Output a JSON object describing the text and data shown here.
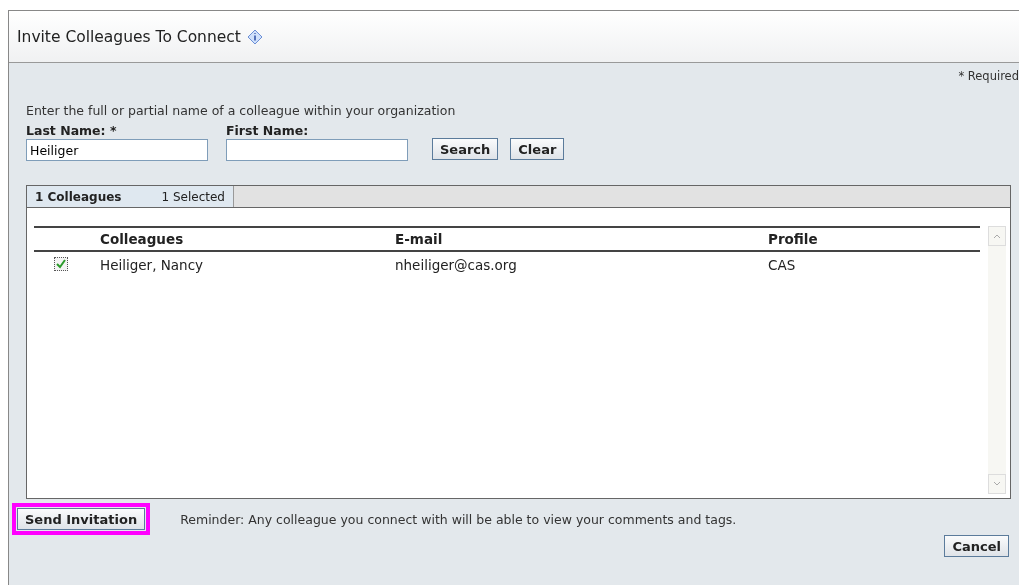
{
  "window": {
    "title": "Invite Colleagues To Connect"
  },
  "required_note": "* Required",
  "instructions": "Enter the full or partial name of a colleague within your organization",
  "fields": [
    {
      "label": "Last Name: *",
      "value": "Heiliger"
    },
    {
      "label": "First Name:"
    }
  ],
  "search_buttons": [
    "Search",
    "Clear"
  ],
  "results": {
    "count": "1 Colleagues",
    "selected_count": "1  Selected",
    "columns": [
      "Colleagues",
      "E-mail",
      "Profile"
    ],
    "rows": [
      {
        "checked": true,
        "cells": [
          "Heiliger, Nancy",
          "nheiliger@cas.org",
          "CAS"
        ]
      }
    ]
  },
  "send_button": {
    "label": "Send Invitation",
    "highlighted": true
  },
  "reminder": "Reminder: Any colleague you connect with will be able to view your comments and tags.",
  "cancel_button": "Cancel"
}
